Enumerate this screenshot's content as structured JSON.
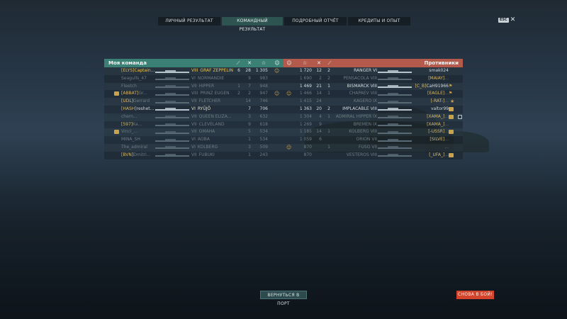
{
  "tabs": [
    "ЛИЧНЫЙ РЕЗУЛЬТАТ",
    "КОМАНДНЫЙ РЕЗУЛЬТАТ",
    "ПОДРОБНЫЙ ОТЧЁТ",
    "КРЕДИТЫ И ОПЫТ"
  ],
  "active_tab": 1,
  "esc_label": "ESC",
  "close_glyph": "✕",
  "header": {
    "left_title": "Моя команда",
    "right_title": "Противники",
    "icons": [
      "ship-destroyed-icon",
      "frags-icon",
      "star-xp-icon",
      "laurel-icon"
    ],
    "left_color": "#3b8074",
    "right_color": "#b45a4c"
  },
  "left_rows": [
    {
      "clan": "[ELYS]",
      "name": "Captain...",
      "tier": "VIII",
      "ship": "GRAF ZEPPELIN",
      "c1": "6",
      "c2": "28",
      "xp": "1 305",
      "alive": true,
      "highlight": true,
      "medal": true
    },
    {
      "clan": "",
      "name": "Seagulls_47",
      "tier": "VI",
      "ship": "NORMANDIE",
      "c1": "",
      "c2": "9",
      "xp": "983",
      "alive": false
    },
    {
      "clan": "",
      "name": "Fleetch",
      "tier": "VII",
      "ship": "HIPPER",
      "c1": "1",
      "c2": "7",
      "xp": "948",
      "alive": false
    },
    {
      "clan": "[ABBAT]",
      "name": "Gr...",
      "tier": "VIII",
      "ship": "PRINZ EUGEN",
      "c1": "2",
      "c2": "2",
      "xp": "947",
      "alive": false,
      "badge": true,
      "medal": true
    },
    {
      "clan": "[UDL]",
      "name": "Gerrard",
      "tier": "VII",
      "ship": "FLETCHER",
      "c1": "",
      "c2": "14",
      "xp": "746",
      "alive": false
    },
    {
      "clan": "[HASH]",
      "name": "reshet...",
      "tier": "VI",
      "ship": "RYŪJŌ",
      "c1": "",
      "c2": "7",
      "xp": "706",
      "alive": true
    },
    {
      "clan": "",
      "name": "chern...",
      "tier": "VII",
      "ship": "QUEEN ELIZA...",
      "c1": "",
      "c2": "3",
      "xp": "632",
      "alive": false
    },
    {
      "clan": "[597]",
      "name": "Ka...",
      "tier": "VII",
      "ship": "CLEVELAND",
      "c1": "",
      "c2": "9",
      "xp": "618",
      "alive": false
    },
    {
      "clan": "",
      "name": "Vinci_...",
      "tier": "VII",
      "ship": "OMAHA",
      "c1": "",
      "c2": "5",
      "xp": "534",
      "alive": false,
      "badge": true
    },
    {
      "clan": "",
      "name": "MINA_SH",
      "tier": "VI",
      "ship": "AOBA",
      "c1": "",
      "c2": "1",
      "xp": "534",
      "alive": false
    },
    {
      "clan": "",
      "name": "The_admiral",
      "tier": "VI",
      "ship": "KOLBERG",
      "c1": "",
      "c2": "3",
      "xp": "509",
      "alive": false
    },
    {
      "clan": "[BVN]",
      "name": "Dmitri...",
      "tier": "VII",
      "ship": "FUBUKI",
      "c1": "",
      "c2": "1",
      "xp": "243",
      "alive": false
    }
  ],
  "right_rows": [
    {
      "xp": "1 720",
      "c2": "12",
      "c1": "2",
      "ship": "RANGER",
      "tier": "VI",
      "clan": "",
      "name": "smak024",
      "alive": true
    },
    {
      "xp": "1 690",
      "c2": "2",
      "c1": "2",
      "ship": "PENSACOLA",
      "tier": "VIII",
      "clan": "[MAIAY]",
      "name": "...",
      "alive": false
    },
    {
      "xp": "1 469",
      "c2": "21",
      "c1": "1",
      "ship": "BISMARCK",
      "tier": "VIII",
      "clan": "[C_B]",
      "name": "CaH91966",
      "alive": true,
      "flag": true
    },
    {
      "xp": "1 466",
      "c2": "14",
      "c1": "1",
      "ship": "CHAPAEV",
      "tier": "VIII",
      "clan": "[EAGLE]",
      "name": "...",
      "alive": false,
      "flag": true,
      "medal": true
    },
    {
      "xp": "1 415",
      "c2": "24",
      "c1": "",
      "ship": "KAGERO",
      "tier": "IX",
      "clan": "[-RAT-]",
      "name": "...",
      "alive": false,
      "star": true
    },
    {
      "xp": "1 363",
      "c2": "20",
      "c1": "2",
      "ship": "IMPLACABLE",
      "tier": "VIII",
      "clan": "",
      "name": "valtor99",
      "alive": true,
      "badge": true
    },
    {
      "xp": "1 304",
      "c2": "4",
      "c1": "1",
      "ship": "ADMIRAL HIPPER",
      "tier": "IX",
      "clan": "[XAMA_]",
      "name": "...",
      "alive": false,
      "badge": true,
      "shield": true
    },
    {
      "xp": "1 269",
      "c2": "9",
      "c1": "",
      "ship": "BREMEN",
      "tier": "IX",
      "clan": "[XAMA_]",
      "name": "...",
      "alive": false
    },
    {
      "xp": "1 185",
      "c2": "14",
      "c1": "1",
      "ship": "KOLBERG",
      "tier": "VIII",
      "clan": "[-USSR]",
      "name": "...",
      "alive": false,
      "badge": true
    },
    {
      "xp": "1 059",
      "c2": "6",
      "c1": "",
      "ship": "ORION",
      "tier": "VII",
      "clan": "[SILVE]",
      "name": "...",
      "alive": false
    },
    {
      "xp": "870",
      "c2": "",
      "c1": "1",
      "ship": "FUSO",
      "tier": "VII",
      "clan": "",
      "name": "...",
      "alive": false,
      "medal": true
    },
    {
      "xp": "870",
      "c2": "",
      "c1": "",
      "ship": "VESTEROS",
      "tier": "VIII",
      "clan": "[_UFA_]",
      "name": "...",
      "alive": false,
      "badge": true
    }
  ],
  "buttons": {
    "port": "ВЕРНУТЬСЯ В ПОРТ",
    "battle": "СНОВА В БОЙ!"
  }
}
